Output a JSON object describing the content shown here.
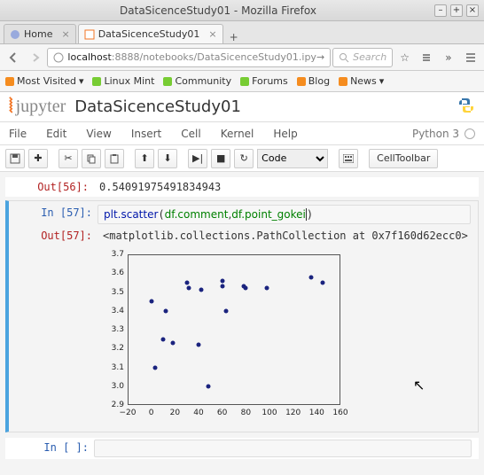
{
  "window": {
    "title": "DataSicenceStudy01 - Mozilla Firefox"
  },
  "tabs": [
    {
      "label": "Home"
    },
    {
      "label": "DataSicenceStudy01"
    }
  ],
  "address": {
    "host": "localhost",
    "port": ":8888",
    "path": "/notebooks/DataSicenceStudy01.ipy"
  },
  "search": {
    "placeholder": "Search"
  },
  "bookmarks": [
    {
      "label": "Most Visited",
      "dropdown": true
    },
    {
      "label": "Linux Mint"
    },
    {
      "label": "Community"
    },
    {
      "label": "Forums"
    },
    {
      "label": "Blog"
    },
    {
      "label": "News",
      "dropdown": true
    }
  ],
  "notebook": {
    "logo_word": "jupyter",
    "title": "DataSicenceStudy01",
    "kernel_name": "Python 3"
  },
  "menubar": [
    "File",
    "Edit",
    "View",
    "Insert",
    "Cell",
    "Kernel",
    "Help"
  ],
  "toolbar": {
    "cell_type": "Code",
    "cell_toolbar_label": "CellToolbar"
  },
  "cells": {
    "prev_out": {
      "prompt": "Out[56]:",
      "text": "0.54091975491834943"
    },
    "code_in": {
      "prompt": "In [57]:",
      "call": "plt.scatter",
      "arg1": "df.comment",
      "comma": ",",
      "arg2": "df.point_gokei"
    },
    "code_out": {
      "prompt": "Out[57]:",
      "text": "<matplotlib.collections.PathCollection at 0x7f160d62ecc0>"
    },
    "empty_in": {
      "prompt": "In [ ]:"
    }
  },
  "chart_data": {
    "type": "scatter",
    "xlabel": "",
    "ylabel": "",
    "xlim": [
      -20,
      160
    ],
    "ylim": [
      2.9,
      3.7
    ],
    "xticks": [
      -20,
      0,
      20,
      40,
      60,
      80,
      100,
      120,
      140,
      160
    ],
    "yticks": [
      2.9,
      3.0,
      3.1,
      3.2,
      3.3,
      3.4,
      3.5,
      3.6,
      3.7
    ],
    "series": [
      {
        "name": "scatter",
        "points": [
          [
            0,
            3.45
          ],
          [
            3,
            3.1
          ],
          [
            10,
            3.25
          ],
          [
            12,
            3.4
          ],
          [
            18,
            3.23
          ],
          [
            30,
            3.55
          ],
          [
            32,
            3.52
          ],
          [
            40,
            3.22
          ],
          [
            42,
            3.51
          ],
          [
            48,
            3.0
          ],
          [
            60,
            3.53
          ],
          [
            60,
            3.56
          ],
          [
            63,
            3.4
          ],
          [
            78,
            3.53
          ],
          [
            80,
            3.52
          ],
          [
            98,
            3.52
          ],
          [
            135,
            3.58
          ],
          [
            145,
            3.55
          ]
        ]
      }
    ]
  }
}
